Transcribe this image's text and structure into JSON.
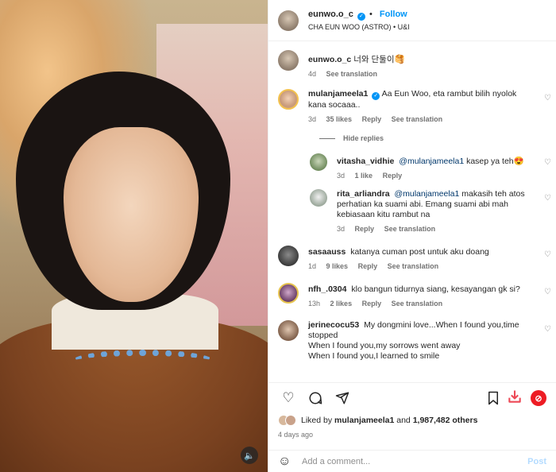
{
  "header": {
    "username": "eunwo.o_c",
    "follow_label": "Follow",
    "subtitle": "CHA EUN WOO (ASTRO) • U&I"
  },
  "caption": {
    "username": "eunwo.o_c",
    "text": "너와 단둘이🥞",
    "age": "4d",
    "see_translation": "See translation"
  },
  "comments": [
    {
      "username": "mulanjameela1",
      "verified": true,
      "text": "Aa Eun Woo, eta rambut bilih nyolok kana socaaa..",
      "age": "3d",
      "likes": "35 likes",
      "reply": "Reply",
      "see_translation": "See translation",
      "hide_replies": "Hide replies",
      "replies": [
        {
          "username": "vitasha_vidhie",
          "mention": "@mulanjameela1",
          "text": "kasep ya teh😍",
          "age": "3d",
          "likes": "1 like",
          "reply": "Reply"
        },
        {
          "username": "rita_arliandra",
          "mention": "@mulanjameela1",
          "text": "makasih teh atos perhatian ka suami abi. Emang suami abi mah kebiasaan kitu rambut na",
          "age": "3d",
          "reply": "Reply",
          "see_translation": "See translation"
        }
      ]
    },
    {
      "username": "sasaauss",
      "text": "katanya cuman post untuk aku doang",
      "age": "1d",
      "likes": "9 likes",
      "reply": "Reply",
      "see_translation": "See translation"
    },
    {
      "username": "nfh_.0304",
      "text": "klo bangun tidurnya siang, kesayangan gk si?",
      "age": "13h",
      "likes": "2 likes",
      "reply": "Reply",
      "see_translation": "See translation"
    },
    {
      "username": "jerinecocu53",
      "text_lines": [
        "My dongmini love...When I found you,time stopped",
        "When I found you,my sorrows went away",
        "When I found you,I learned to smile"
      ]
    }
  ],
  "likes": {
    "prefix": "Liked by",
    "user": "mulanjameela1",
    "and": "and",
    "count": "1,987,482 others"
  },
  "date": "4 days ago",
  "add_comment": {
    "placeholder": "Add a comment...",
    "post_label": "Post"
  },
  "colors": {
    "accent": "#0095f6",
    "muted": "#737373",
    "download": "#ed4956"
  }
}
